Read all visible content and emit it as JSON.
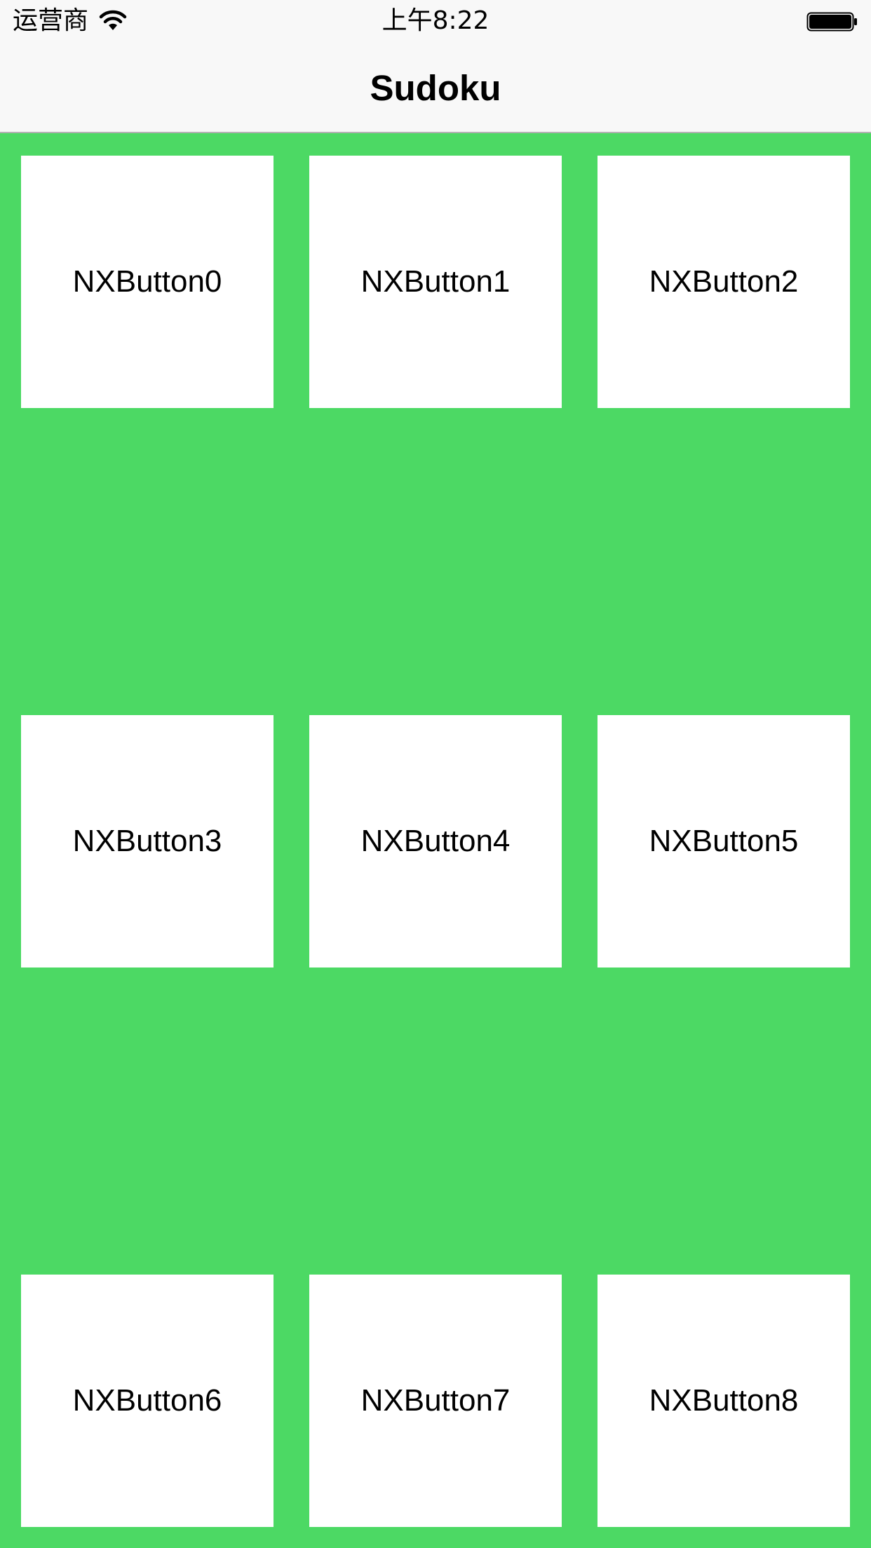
{
  "status_bar": {
    "carrier": "运营商",
    "time": "上午8:22",
    "wifi_icon": "wifi-icon",
    "battery_icon": "battery-icon"
  },
  "nav_bar": {
    "title": "Sudoku"
  },
  "grid": {
    "background_color": "#4cd964",
    "cell_color": "#ffffff",
    "buttons": [
      {
        "label": "NXButton0"
      },
      {
        "label": "NXButton1"
      },
      {
        "label": "NXButton2"
      },
      {
        "label": "NXButton3"
      },
      {
        "label": "NXButton4"
      },
      {
        "label": "NXButton5"
      },
      {
        "label": "NXButton6"
      },
      {
        "label": "NXButton7"
      },
      {
        "label": "NXButton8"
      }
    ]
  }
}
